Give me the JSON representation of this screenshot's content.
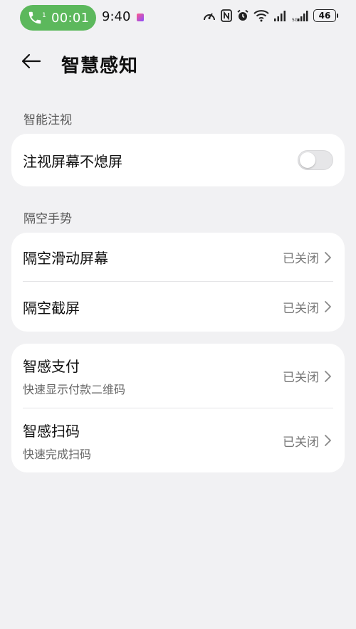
{
  "status_bar": {
    "call_timer": "00:01",
    "call_sim": "1",
    "clock": "9:40",
    "battery": "46",
    "icons": [
      "speed-icon",
      "nfc-icon",
      "alarm-icon",
      "wifi-icon",
      "signal-icon",
      "signal-icon-2"
    ]
  },
  "header": {
    "title": "智慧感知"
  },
  "sections": {
    "gaze_label": "智能注视",
    "gesture_label": "隔空手势"
  },
  "gaze_card": {
    "row_title": "注视屏幕不熄屏",
    "toggle_on": false
  },
  "gesture_card": {
    "rows": [
      {
        "title": "隔空滑动屏幕",
        "status": "已关闭"
      },
      {
        "title": "隔空截屏",
        "status": "已关闭"
      }
    ]
  },
  "smart_card": {
    "rows": [
      {
        "title": "智感支付",
        "subtitle": "快速显示付款二维码",
        "status": "已关闭"
      },
      {
        "title": "智感扫码",
        "subtitle": "快速完成扫码",
        "status": "已关闭"
      }
    ]
  },
  "colors": {
    "call_pill": "#5cb85c",
    "background": "#f1f1f3",
    "card": "#ffffff"
  }
}
